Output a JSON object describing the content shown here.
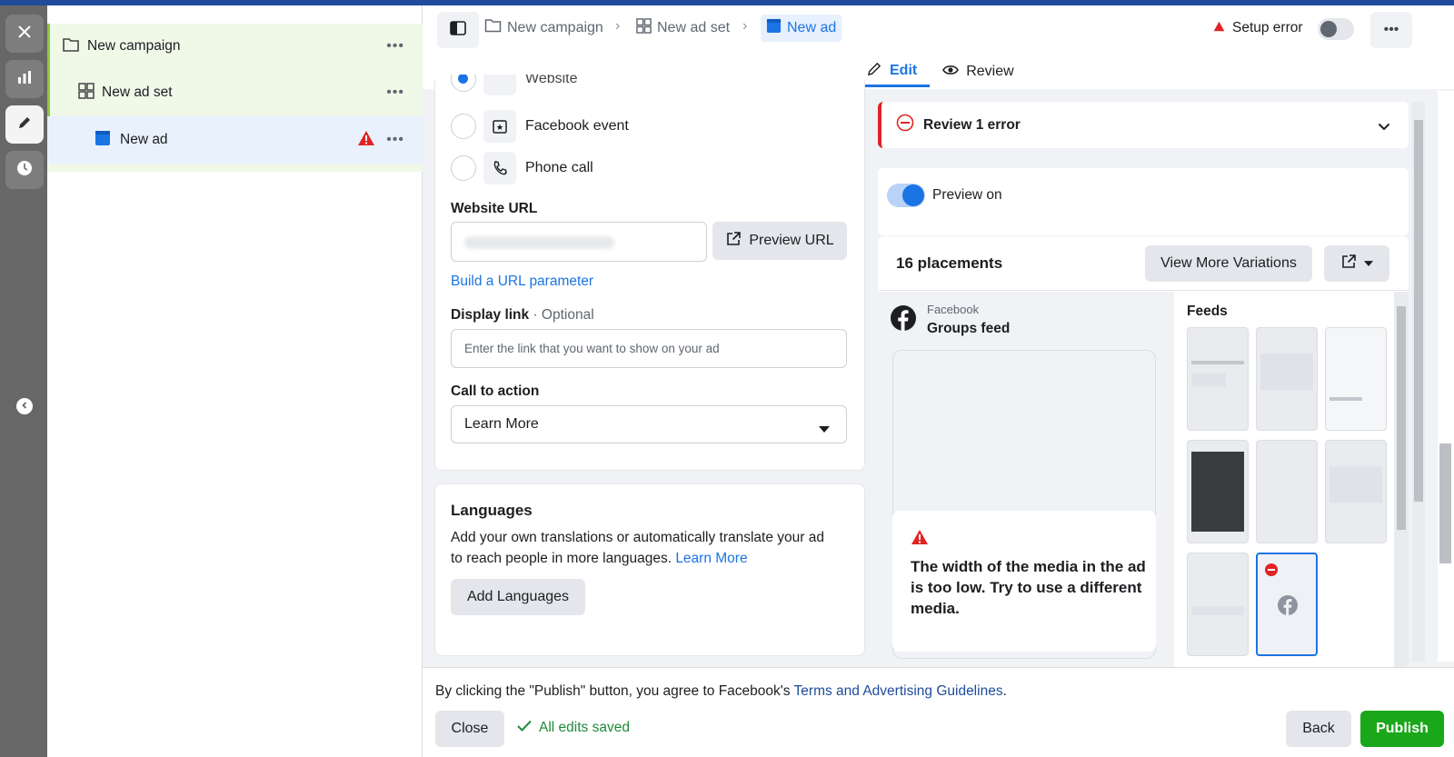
{
  "tree": {
    "items": [
      {
        "label": "New campaign",
        "icon": "folder-icon"
      },
      {
        "label": "New ad set",
        "icon": "grid-icon"
      },
      {
        "label": "New ad",
        "icon": "ad-icon"
      }
    ],
    "more": "•••"
  },
  "header": {
    "breadcrumbs": [
      "New campaign",
      "New ad set",
      "New ad"
    ],
    "setup_error": "Setup error",
    "more": "•••"
  },
  "tabs": [
    {
      "label": "Edit",
      "icon": "pencil-icon"
    },
    {
      "label": "Review",
      "icon": "eye-icon"
    }
  ],
  "destination": {
    "partial_label": "Website",
    "options": [
      {
        "label": "Facebook event",
        "icon": "event-icon"
      },
      {
        "label": "Phone call",
        "icon": "phone-icon"
      }
    ]
  },
  "website_url": {
    "label": "Website URL",
    "preview_button": "Preview URL",
    "build_link": "Build a URL parameter"
  },
  "display_link": {
    "label": "Display link",
    "optional": " · Optional",
    "placeholder": "Enter the link that you want to show on your ad"
  },
  "cta": {
    "label": "Call to action",
    "value": "Learn More"
  },
  "languages": {
    "title": "Languages",
    "desc_line1": "Add your own translations or automatically translate your ad",
    "desc_line2": "to reach people in more languages.",
    "learn_more": "Learn More",
    "button": "Add Languages"
  },
  "review": {
    "title": "Review 1 error"
  },
  "preview": {
    "toggle_label": "Preview on",
    "placements_title": "16 placements",
    "variations_button": "View More Variations",
    "platform": "Facebook",
    "placement": "Groups feed",
    "feeds_title": "Feeds",
    "error_message": "The width of the media in the ad is too low. Try to use a different media."
  },
  "footer": {
    "agree_text": "By clicking the \"Publish\" button, you agree to Facebook's",
    "terms_link": "Terms and Advertising Guidelines",
    "period": ".",
    "close": "Close",
    "saved": "All edits saved",
    "back": "Back",
    "publish": "Publish"
  },
  "colors": {
    "accent": "#1b74e4",
    "publish": "#1aa81a",
    "error": "#e02424",
    "saved": "#1e8a3a"
  }
}
